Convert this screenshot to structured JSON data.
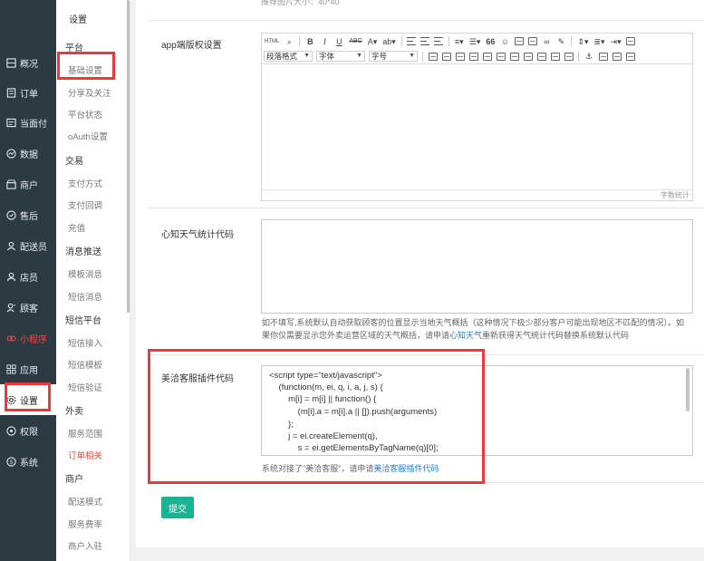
{
  "leftnav": [
    {
      "label": "概况",
      "icon": "dashboard-icon"
    },
    {
      "label": "订单",
      "icon": "order-icon"
    },
    {
      "label": "当面付",
      "icon": "pay-icon"
    },
    {
      "label": "数据",
      "icon": "data-icon"
    },
    {
      "label": "商户",
      "icon": "shop-icon"
    },
    {
      "label": "售后",
      "icon": "aftersale-icon"
    },
    {
      "label": "配送员",
      "icon": "courier-icon"
    },
    {
      "label": "店员",
      "icon": "clerk-icon"
    },
    {
      "label": "顾客",
      "icon": "customer-icon"
    },
    {
      "label": "小程序",
      "icon": "miniapp-icon"
    },
    {
      "label": "应用",
      "icon": "apps-icon"
    },
    {
      "label": "设置",
      "icon": "gear-icon"
    },
    {
      "label": "权限",
      "icon": "lock-icon"
    },
    {
      "label": "系统",
      "icon": "system-icon"
    }
  ],
  "submenu": {
    "title": "设置",
    "groups": [
      {
        "label": "平台"
      },
      {
        "label": "交易"
      },
      {
        "label": "消息推送"
      },
      {
        "label": "短信平台"
      },
      {
        "label": "外卖"
      },
      {
        "label": "商户"
      }
    ],
    "items": [
      {
        "label": "基础设置"
      },
      {
        "label": "分享及关注"
      },
      {
        "label": "平台状态"
      },
      {
        "label": "oAuth设置"
      },
      {
        "label": "支付方式"
      },
      {
        "label": "支付回调"
      },
      {
        "label": "充值"
      },
      {
        "label": "模板消息"
      },
      {
        "label": "短信消息"
      },
      {
        "label": "短信接入"
      },
      {
        "label": "短信模板"
      },
      {
        "label": "短信验证"
      },
      {
        "label": "服务范围"
      },
      {
        "label": "订单相关"
      },
      {
        "label": "配送模式"
      },
      {
        "label": "服务费率"
      },
      {
        "label": "商户入驻"
      }
    ]
  },
  "main": {
    "top_note": "推荐图片大小：40*40",
    "app_label": "app端版权设置",
    "editor": {
      "html_btn": "HTML",
      "row1": [
        "B",
        "I",
        "U",
        "ABC",
        "A▾",
        "ab▾",
        "66",
        "Ω"
      ],
      "para_format": "段落格式",
      "font_family": "字体",
      "font_size": "字号",
      "word_count": "字数统计"
    },
    "weather_label": "心知天气统计代码",
    "weather_help_a": "如不填写,系统默认自动获取顾客的位置显示当地天气概括（这种情况下极少部分客户可能出现地区不匹配的情况）。如果你仅需要显示您外卖运营区域的天气概括，请申请",
    "weather_help_link": "心知天气",
    "weather_help_b": "重新获得天气统计代码替换系统默认代码",
    "meiqia_label": "美洽客服插件代码",
    "code_lines": [
      "<script type=\"text/javascript\">",
      "    (function(m, ei, q, i, a, j, s) {",
      "        m[i] = m[i] || function() {",
      "            (m[i].a = m[i].a || []).push(arguments)",
      "        };",
      "        j = ei.createElement(q),",
      "            s = ei.getElementsByTagName(q)[0];"
    ],
    "meiqia_help_a": "系统对接了\"美洽客服\"，请申请",
    "meiqia_help_link": "美洽客服插件代码",
    "submit_label": "提交"
  },
  "colors": {
    "sidebar": "#2c3a42",
    "accent_red": "#e83a3a",
    "submit_green": "#1ab394",
    "link_blue": "#2a7ac4"
  }
}
